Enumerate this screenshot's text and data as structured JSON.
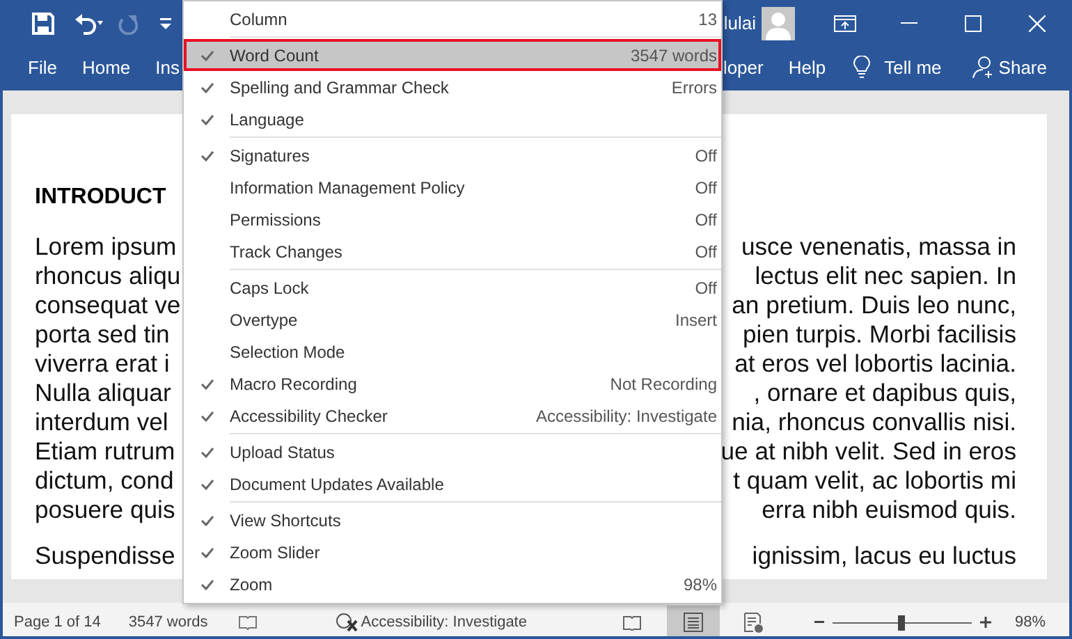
{
  "title_bar": {
    "user_name": "lulai"
  },
  "ribbon": {
    "tabs_left": [
      "File",
      "Home",
      "Ins"
    ],
    "tabs_right": [
      "loper",
      "Help"
    ],
    "tell_me": "Tell me",
    "share": "Share"
  },
  "document": {
    "heading": "INTRODUCT",
    "paragraphs": [
      {
        "lines": [
          {
            "left": "Lorem ipsum",
            "right": "usce venenatis, massa in"
          },
          {
            "left": "rhoncus aliqu",
            "right": "lectus elit nec sapien. In"
          },
          {
            "left": "consequat ve",
            "right": "an pretium. Duis leo nunc,"
          },
          {
            "left": "porta sed tin",
            "right": "pien turpis. Morbi facilisis"
          },
          {
            "left": "viverra erat i",
            "right": "at eros vel lobortis lacinia."
          },
          {
            "left": "Nulla aliquar",
            "right": ", ornare et dapibus quis,"
          },
          {
            "left": "interdum vel",
            "right": "nia, rhoncus convallis nisi."
          },
          {
            "left": "Etiam rutrum",
            "right": "ue at nibh velit. Sed in eros"
          },
          {
            "left": "dictum, cond",
            "right": "t quam velit, ac lobortis mi"
          },
          {
            "left": "posuere quis",
            "right": "erra nibh euismod quis."
          }
        ]
      },
      {
        "lines": [
          {
            "left": "Suspendisse",
            "right": "ignissim, lacus eu luctus"
          }
        ]
      }
    ]
  },
  "status_bar": {
    "page": "Page 1 of 14",
    "words": "3547 words",
    "accessibility": "Accessibility: Investigate",
    "views": [
      {
        "kind": "read",
        "selected": false
      },
      {
        "kind": "print",
        "selected": true
      },
      {
        "kind": "web",
        "selected": false
      }
    ],
    "zoom": {
      "level": 0.49,
      "reading": "98%"
    }
  },
  "context_menu": {
    "groups": [
      {
        "items": [
          {
            "label": "Column",
            "value": "13",
            "checked": false,
            "selected": false
          }
        ]
      },
      {
        "items": [
          {
            "label": "Word Count",
            "value": "3547 words",
            "checked": true,
            "selected": true
          },
          {
            "label": "Spelling and Grammar Check",
            "value": "Errors",
            "checked": true,
            "selected": false
          },
          {
            "label": "Language",
            "checked": true,
            "selected": false
          }
        ]
      },
      {
        "items": [
          {
            "label": "Signatures",
            "value": "Off",
            "checked": true,
            "selected": false
          },
          {
            "label": "Information Management Policy",
            "value": "Off",
            "checked": false,
            "selected": false
          },
          {
            "label": "Permissions",
            "value": "Off",
            "checked": false,
            "selected": false
          },
          {
            "label": "Track Changes",
            "value": "Off",
            "checked": false,
            "selected": false
          }
        ]
      },
      {
        "items": [
          {
            "label": "Caps Lock",
            "value": "Off",
            "checked": false,
            "selected": false
          },
          {
            "label": "Overtype",
            "value": "Insert",
            "checked": false,
            "selected": false
          },
          {
            "label": "Selection Mode",
            "checked": false,
            "selected": false
          },
          {
            "label": "Macro Recording",
            "value": "Not Recording",
            "checked": true,
            "selected": false
          },
          {
            "label": "Accessibility Checker",
            "value": "Accessibility: Investigate",
            "checked": true,
            "selected": false
          }
        ]
      },
      {
        "items": [
          {
            "label": "Upload Status",
            "checked": true,
            "selected": false
          },
          {
            "label": "Document Updates Available",
            "checked": true,
            "selected": false
          }
        ]
      },
      {
        "items": [
          {
            "label": "View Shortcuts",
            "checked": true,
            "selected": false
          },
          {
            "label": "Zoom Slider",
            "checked": true,
            "selected": false
          },
          {
            "label": "Zoom",
            "value": "98%",
            "checked": true,
            "selected": false
          }
        ]
      }
    ]
  }
}
